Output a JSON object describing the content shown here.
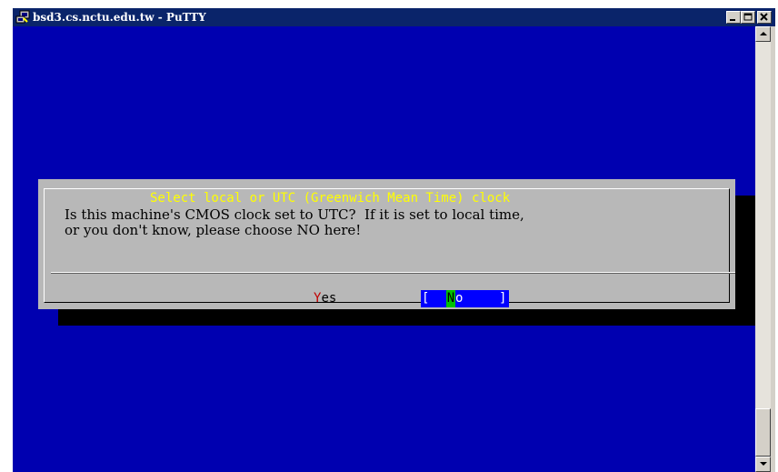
{
  "window": {
    "title": "bsd3.cs.nctu.edu.tw - PuTTY",
    "app_icon": "putty-icon",
    "controls": [
      "minimize-icon",
      "maximize-icon",
      "close-icon"
    ]
  },
  "dialog": {
    "title": "Select local or UTC (Greenwich Mean Time) clock",
    "message_line_1": "Is this machine's CMOS clock set to UTC?  If it is set to local time,",
    "message_line_2": "or you don't know, please choose NO here!",
    "yes_button": {
      "hotkey": "Y",
      "rest": "es"
    },
    "no_button": {
      "open_bracket": "[",
      "hotkey": "N",
      "rest": "o",
      "close_bracket": "]"
    }
  },
  "colors": {
    "terminal_background": "#0000b0",
    "dialog_background": "#b8b8b8",
    "dialog_title": "#ffff00",
    "hotkey_yes": "#c00000",
    "selected_button": "#0000ff",
    "selected_hotkey": "#00c000"
  },
  "scrollbar": {
    "icons": [
      "scroll-up-arrow-icon",
      "scroll-down-arrow-icon"
    ]
  }
}
